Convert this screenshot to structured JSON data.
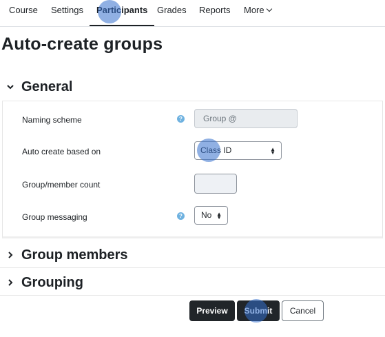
{
  "nav": {
    "items": [
      {
        "label": "Course"
      },
      {
        "label": "Settings"
      },
      {
        "label": "Participants",
        "active": true
      },
      {
        "label": "Grades"
      },
      {
        "label": "Reports"
      },
      {
        "label": "More"
      }
    ]
  },
  "page": {
    "title": "Auto-create groups"
  },
  "sections": {
    "general": {
      "title": "General",
      "expanded": true
    },
    "group_members": {
      "title": "Group members",
      "expanded": false
    },
    "grouping": {
      "title": "Grouping",
      "expanded": false
    }
  },
  "form": {
    "naming_scheme": {
      "label": "Naming scheme",
      "value": "Group @"
    },
    "auto_create": {
      "label": "Auto create based on",
      "selected": "Class ID"
    },
    "count": {
      "label": "Group/member count",
      "value": ""
    },
    "messaging": {
      "label": "Group messaging",
      "selected": "No"
    }
  },
  "buttons": {
    "preview": "Preview",
    "submit": "Submit",
    "cancel": "Cancel"
  },
  "colors": {
    "help_icon": "#6fb2e0",
    "dark_button": "#212529",
    "click_marker": "#3470cc"
  }
}
